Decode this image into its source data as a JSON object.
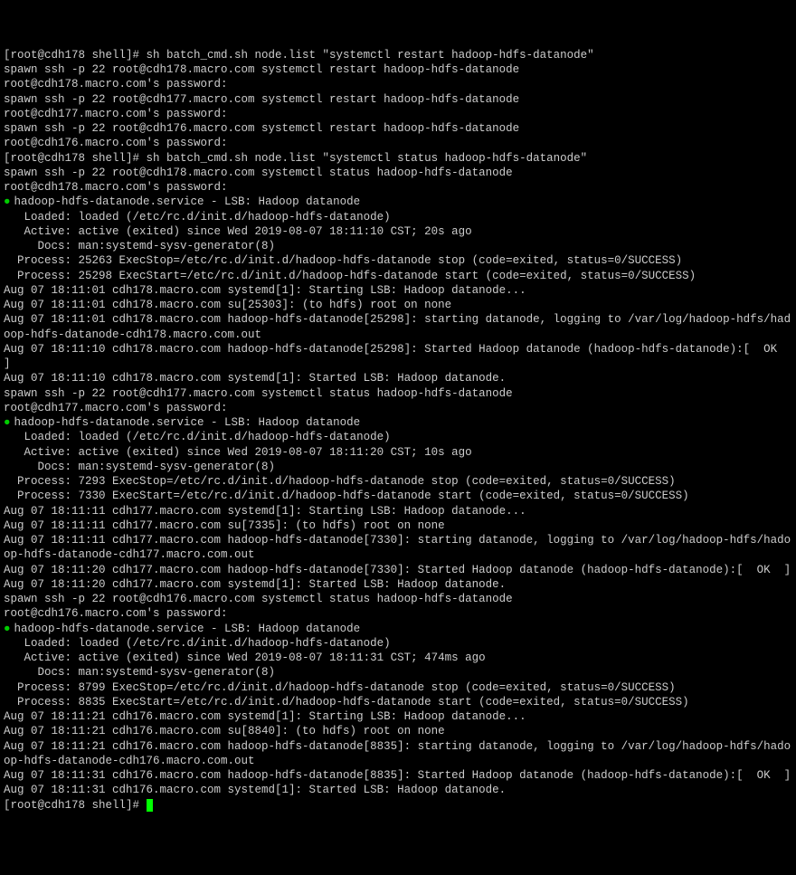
{
  "lines": [
    {
      "t": "[root@cdh178 shell]# sh batch_cmd.sh node.list \"systemctl restart hadoop-hdfs-datanode\""
    },
    {
      "t": "spawn ssh -p 22 root@cdh178.macro.com systemctl restart hadoop-hdfs-datanode"
    },
    {
      "t": "root@cdh178.macro.com's password:"
    },
    {
      "t": "spawn ssh -p 22 root@cdh177.macro.com systemctl restart hadoop-hdfs-datanode"
    },
    {
      "t": "root@cdh177.macro.com's password:"
    },
    {
      "t": "spawn ssh -p 22 root@cdh176.macro.com systemctl restart hadoop-hdfs-datanode"
    },
    {
      "t": "root@cdh176.macro.com's password:"
    },
    {
      "t": "[root@cdh178 shell]# sh batch_cmd.sh node.list \"systemctl status hadoop-hdfs-datanode\""
    },
    {
      "t": "spawn ssh -p 22 root@cdh178.macro.com systemctl status hadoop-hdfs-datanode"
    },
    {
      "t": "root@cdh178.macro.com's password:"
    },
    {
      "b": true,
      "t": "hadoop-hdfs-datanode.service - LSB: Hadoop datanode"
    },
    {
      "t": "   Loaded: loaded (/etc/rc.d/init.d/hadoop-hdfs-datanode)"
    },
    {
      "t": "   Active: active (exited) since Wed 2019-08-07 18:11:10 CST; 20s ago"
    },
    {
      "t": "     Docs: man:systemd-sysv-generator(8)"
    },
    {
      "t": "  Process: 25263 ExecStop=/etc/rc.d/init.d/hadoop-hdfs-datanode stop (code=exited, status=0/SUCCESS)"
    },
    {
      "t": "  Process: 25298 ExecStart=/etc/rc.d/init.d/hadoop-hdfs-datanode start (code=exited, status=0/SUCCESS)"
    },
    {
      "t": ""
    },
    {
      "t": "Aug 07 18:11:01 cdh178.macro.com systemd[1]: Starting LSB: Hadoop datanode..."
    },
    {
      "t": "Aug 07 18:11:01 cdh178.macro.com su[25303]: (to hdfs) root on none"
    },
    {
      "t": "Aug 07 18:11:01 cdh178.macro.com hadoop-hdfs-datanode[25298]: starting datanode, logging to /var/log/hadoop-hdfs/hadoop-hdfs-datanode-cdh178.macro.com.out"
    },
    {
      "t": "Aug 07 18:11:10 cdh178.macro.com hadoop-hdfs-datanode[25298]: Started Hadoop datanode (hadoop-hdfs-datanode):[  OK  ]"
    },
    {
      "t": "Aug 07 18:11:10 cdh178.macro.com systemd[1]: Started LSB: Hadoop datanode."
    },
    {
      "t": "spawn ssh -p 22 root@cdh177.macro.com systemctl status hadoop-hdfs-datanode"
    },
    {
      "t": "root@cdh177.macro.com's password:"
    },
    {
      "b": true,
      "t": "hadoop-hdfs-datanode.service - LSB: Hadoop datanode"
    },
    {
      "t": "   Loaded: loaded (/etc/rc.d/init.d/hadoop-hdfs-datanode)"
    },
    {
      "t": "   Active: active (exited) since Wed 2019-08-07 18:11:20 CST; 10s ago"
    },
    {
      "t": "     Docs: man:systemd-sysv-generator(8)"
    },
    {
      "t": "  Process: 7293 ExecStop=/etc/rc.d/init.d/hadoop-hdfs-datanode stop (code=exited, status=0/SUCCESS)"
    },
    {
      "t": "  Process: 7330 ExecStart=/etc/rc.d/init.d/hadoop-hdfs-datanode start (code=exited, status=0/SUCCESS)"
    },
    {
      "t": ""
    },
    {
      "t": "Aug 07 18:11:11 cdh177.macro.com systemd[1]: Starting LSB: Hadoop datanode..."
    },
    {
      "t": "Aug 07 18:11:11 cdh177.macro.com su[7335]: (to hdfs) root on none"
    },
    {
      "t": "Aug 07 18:11:11 cdh177.macro.com hadoop-hdfs-datanode[7330]: starting datanode, logging to /var/log/hadoop-hdfs/hadoop-hdfs-datanode-cdh177.macro.com.out"
    },
    {
      "t": "Aug 07 18:11:20 cdh177.macro.com hadoop-hdfs-datanode[7330]: Started Hadoop datanode (hadoop-hdfs-datanode):[  OK  ]"
    },
    {
      "t": "Aug 07 18:11:20 cdh177.macro.com systemd[1]: Started LSB: Hadoop datanode."
    },
    {
      "t": "spawn ssh -p 22 root@cdh176.macro.com systemctl status hadoop-hdfs-datanode"
    },
    {
      "t": "root@cdh176.macro.com's password:"
    },
    {
      "b": true,
      "t": "hadoop-hdfs-datanode.service - LSB: Hadoop datanode"
    },
    {
      "t": "   Loaded: loaded (/etc/rc.d/init.d/hadoop-hdfs-datanode)"
    },
    {
      "t": "   Active: active (exited) since Wed 2019-08-07 18:11:31 CST; 474ms ago"
    },
    {
      "t": "     Docs: man:systemd-sysv-generator(8)"
    },
    {
      "t": "  Process: 8799 ExecStop=/etc/rc.d/init.d/hadoop-hdfs-datanode stop (code=exited, status=0/SUCCESS)"
    },
    {
      "t": "  Process: 8835 ExecStart=/etc/rc.d/init.d/hadoop-hdfs-datanode start (code=exited, status=0/SUCCESS)"
    },
    {
      "t": ""
    },
    {
      "t": "Aug 07 18:11:21 cdh176.macro.com systemd[1]: Starting LSB: Hadoop datanode..."
    },
    {
      "t": "Aug 07 18:11:21 cdh176.macro.com su[8840]: (to hdfs) root on none"
    },
    {
      "t": "Aug 07 18:11:21 cdh176.macro.com hadoop-hdfs-datanode[8835]: starting datanode, logging to /var/log/hadoop-hdfs/hadoop-hdfs-datanode-cdh176.macro.com.out"
    },
    {
      "t": "Aug 07 18:11:31 cdh176.macro.com hadoop-hdfs-datanode[8835]: Started Hadoop datanode (hadoop-hdfs-datanode):[  OK  ]"
    },
    {
      "t": "Aug 07 18:11:31 cdh176.macro.com systemd[1]: Started LSB: Hadoop datanode."
    }
  ],
  "prompt": "[root@cdh178 shell]# "
}
